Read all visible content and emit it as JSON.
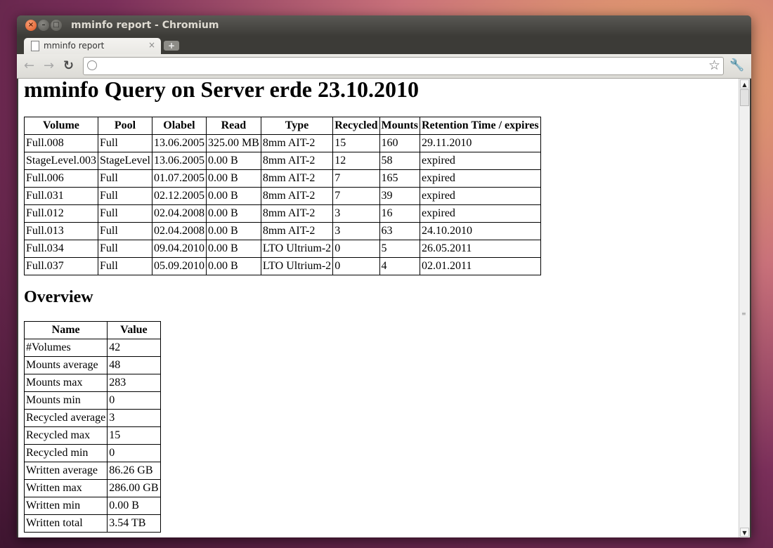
{
  "window": {
    "title": "mminfo report - Chromium"
  },
  "tab": {
    "title": "mminfo report",
    "close": "×"
  },
  "newtab": {
    "label": "+"
  },
  "toolbar": {
    "back": "←",
    "forward": "→",
    "reload": "↻",
    "address_value": "",
    "star": "☆",
    "wrench": "🔧"
  },
  "page": {
    "title": "mminfo Query on Server erde 23.10.2010",
    "volumes": {
      "headers": [
        "Volume",
        "Pool",
        "Olabel",
        "Read",
        "Type",
        "Recycled",
        "Mounts",
        "Retention Time / expires"
      ],
      "rows": [
        [
          "Full.008",
          "Full",
          "13.06.2005",
          "325.00 MB",
          "8mm AIT-2",
          "15",
          "160",
          "29.11.2010"
        ],
        [
          "StageLevel.003",
          "StageLevel",
          "13.06.2005",
          "0.00 B",
          "8mm AIT-2",
          "12",
          "58",
          "expired"
        ],
        [
          "Full.006",
          "Full",
          "01.07.2005",
          "0.00 B",
          "8mm AIT-2",
          "7",
          "165",
          "expired"
        ],
        [
          "Full.031",
          "Full",
          "02.12.2005",
          "0.00 B",
          "8mm AIT-2",
          "7",
          "39",
          "expired"
        ],
        [
          "Full.012",
          "Full",
          "02.04.2008",
          "0.00 B",
          "8mm AIT-2",
          "3",
          "16",
          "expired"
        ],
        [
          "Full.013",
          "Full",
          "02.04.2008",
          "0.00 B",
          "8mm AIT-2",
          "3",
          "63",
          "24.10.2010"
        ],
        [
          "Full.034",
          "Full",
          "09.04.2010",
          "0.00 B",
          "LTO Ultrium-2",
          "0",
          "5",
          "26.05.2011"
        ],
        [
          "Full.037",
          "Full",
          "05.09.2010",
          "0.00 B",
          "LTO Ultrium-2",
          "0",
          "4",
          "02.01.2011"
        ]
      ]
    },
    "overview": {
      "heading": "Overview",
      "headers": [
        "Name",
        "Value"
      ],
      "rows": [
        [
          "#Volumes",
          "42"
        ],
        [
          "Mounts average",
          "48"
        ],
        [
          "Mounts max",
          "283"
        ],
        [
          "Mounts min",
          "0"
        ],
        [
          "Recycled average",
          "3"
        ],
        [
          "Recycled max",
          "15"
        ],
        [
          "Recycled min",
          "0"
        ],
        [
          "Written average",
          "86.26 GB"
        ],
        [
          "Written max",
          "286.00 GB"
        ],
        [
          "Written min",
          "0.00 B"
        ],
        [
          "Written total",
          "3.54 TB"
        ]
      ]
    }
  }
}
